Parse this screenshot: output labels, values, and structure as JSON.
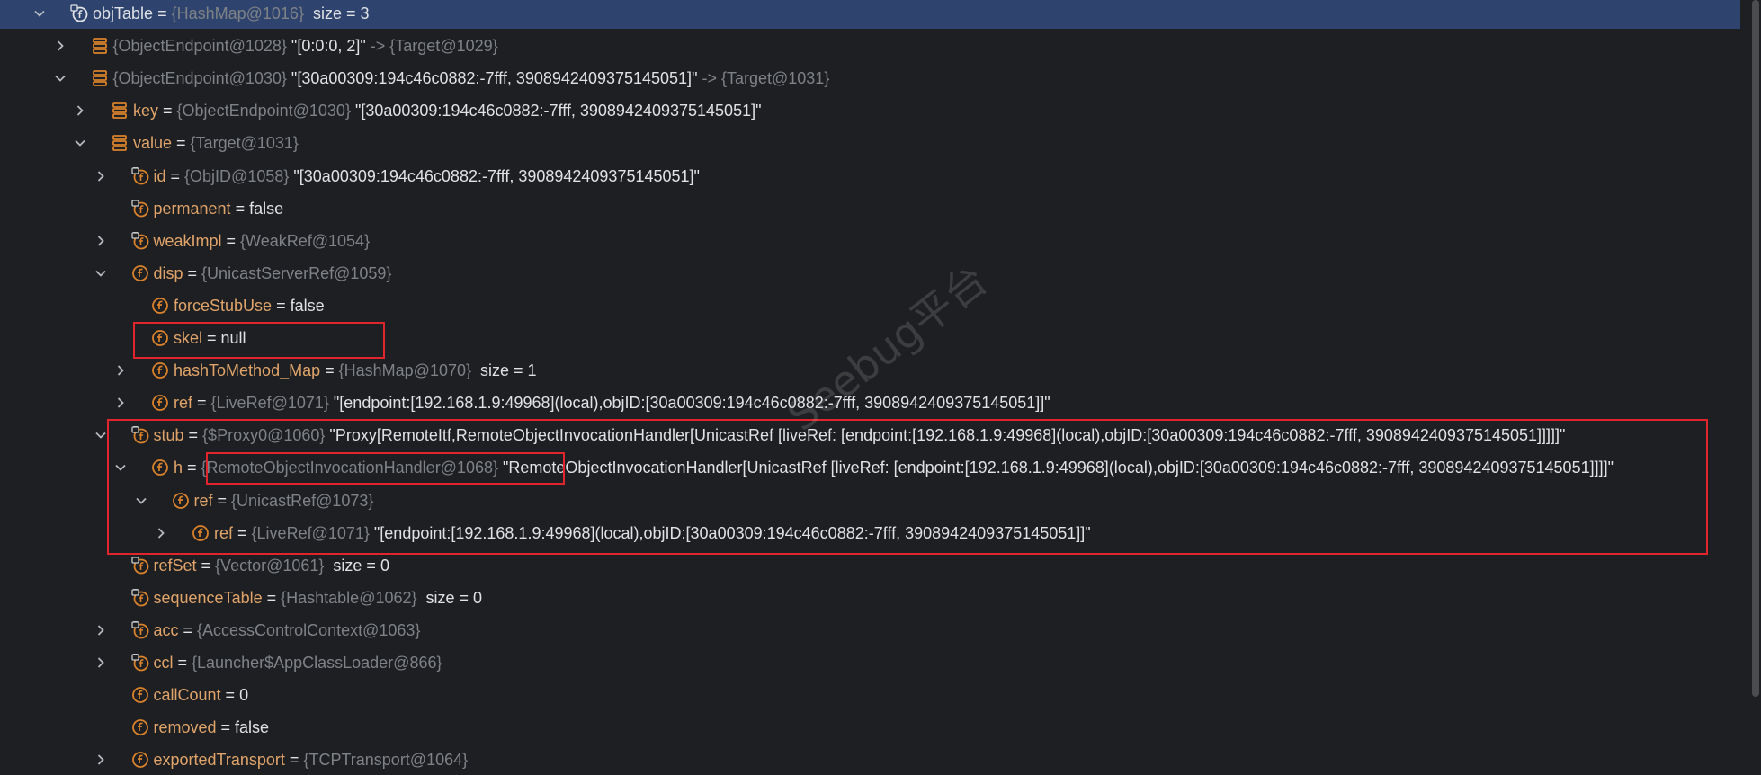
{
  "rows": [
    {
      "depth": 0,
      "expand": "open",
      "icon": "watch-icon",
      "selected": true,
      "name": "objTable",
      "op": " = ",
      "ref": "{HashMap@1016}",
      "value": "  size = 3",
      "name_color": "#dfe1e5"
    },
    {
      "depth": 1,
      "expand": "closed",
      "icon": "array-icon",
      "name": "",
      "op": "",
      "ref": "{ObjectEndpoint@1028}",
      "value": " \"[0:0:0, 2]\"",
      "suffix": " -> {Target@1029}"
    },
    {
      "depth": 1,
      "expand": "open",
      "icon": "array-icon",
      "name": "",
      "op": "",
      "ref": "{ObjectEndpoint@1030}",
      "value": " \"[30a00309:194c46c0882:-7fff, 3908942409375145051]\"",
      "suffix": " -> {Target@1031}"
    },
    {
      "depth": 2,
      "expand": "closed",
      "icon": "array-icon",
      "name": "key",
      "op": " = ",
      "ref": "{ObjectEndpoint@1030}",
      "value": " \"[30a00309:194c46c0882:-7fff, 3908942409375145051]\""
    },
    {
      "depth": 2,
      "expand": "open",
      "icon": "array-icon",
      "name": "value",
      "op": " = ",
      "ref": "{Target@1031}",
      "value": ""
    },
    {
      "depth": 3,
      "expand": "closed",
      "icon": "private-field-icon",
      "name": "id",
      "op": " = ",
      "ref": "{ObjID@1058}",
      "value": " \"[30a00309:194c46c0882:-7fff, 3908942409375145051]\""
    },
    {
      "depth": 3,
      "expand": "none",
      "icon": "private-field-icon",
      "name": "permanent",
      "op": " = ",
      "ref": "",
      "value": "false"
    },
    {
      "depth": 3,
      "expand": "closed",
      "icon": "private-field-icon",
      "name": "weakImpl",
      "op": " = ",
      "ref": "{WeakRef@1054}",
      "value": ""
    },
    {
      "depth": 3,
      "expand": "open",
      "icon": "field-icon",
      "name": "disp",
      "op": " = ",
      "ref": "{UnicastServerRef@1059}",
      "value": ""
    },
    {
      "depth": 4,
      "expand": "none",
      "icon": "field-icon",
      "name": "forceStubUse",
      "op": " = ",
      "ref": "",
      "value": "false"
    },
    {
      "depth": 4,
      "expand": "none",
      "icon": "field-icon",
      "name": "skel",
      "op": " = ",
      "ref": "",
      "value": "null"
    },
    {
      "depth": 4,
      "expand": "closed",
      "icon": "field-icon",
      "name": "hashToMethod_Map",
      "op": " = ",
      "ref": "{HashMap@1070}",
      "value": "  size = 1"
    },
    {
      "depth": 4,
      "expand": "closed",
      "icon": "field-icon",
      "name": "ref",
      "op": " = ",
      "ref": "{LiveRef@1071}",
      "value": " \"[endpoint:[192.168.1.9:49968](local),objID:[30a00309:194c46c0882:-7fff, 3908942409375145051]]\""
    },
    {
      "depth": 3,
      "expand": "open",
      "icon": "private-field-icon",
      "name": "stub",
      "op": " = ",
      "ref": "{$Proxy0@1060}",
      "value": " \"Proxy[RemoteItf,RemoteObjectInvocationHandler[UnicastRef [liveRef: [endpoint:[192.168.1.9:49968](local),objID:[30a00309:194c46c0882:-7fff, 3908942409375145051]]]]]\""
    },
    {
      "depth": 4,
      "expand": "open",
      "icon": "field-icon",
      "name": "h",
      "op": " = ",
      "ref": "{RemoteObjectInvocationHandler@1068}",
      "value": " \"RemoteObjectInvocationHandler[UnicastRef [liveRef: [endpoint:[192.168.1.9:49968](local),objID:[30a00309:194c46c0882:-7fff, 3908942409375145051]]]]\""
    },
    {
      "depth": 5,
      "expand": "open",
      "icon": "field-icon",
      "name": "ref",
      "op": " = ",
      "ref": "{UnicastRef@1073}",
      "value": ""
    },
    {
      "depth": 6,
      "expand": "closed",
      "icon": "field-icon",
      "name": "ref",
      "op": " = ",
      "ref": "{LiveRef@1071}",
      "value": " \"[endpoint:[192.168.1.9:49968](local),objID:[30a00309:194c46c0882:-7fff, 3908942409375145051]]\""
    },
    {
      "depth": 3,
      "expand": "none",
      "icon": "private-field-icon",
      "name": "refSet",
      "op": " = ",
      "ref": "{Vector@1061}",
      "value": "  size = 0"
    },
    {
      "depth": 3,
      "expand": "none",
      "icon": "private-field-icon",
      "name": "sequenceTable",
      "op": " = ",
      "ref": "{Hashtable@1062}",
      "value": "  size = 0"
    },
    {
      "depth": 3,
      "expand": "closed",
      "icon": "private-field-icon",
      "name": "acc",
      "op": " = ",
      "ref": "{AccessControlContext@1063}",
      "value": ""
    },
    {
      "depth": 3,
      "expand": "closed",
      "icon": "private-field-icon",
      "name": "ccl",
      "op": " = ",
      "ref": "{Launcher$AppClassLoader@866}",
      "value": ""
    },
    {
      "depth": 3,
      "expand": "none",
      "icon": "field-icon",
      "name": "callCount",
      "op": " = ",
      "ref": "",
      "value": "0"
    },
    {
      "depth": 3,
      "expand": "none",
      "icon": "field-icon",
      "name": "removed",
      "op": " = ",
      "ref": "",
      "value": "false"
    },
    {
      "depth": 3,
      "expand": "closed",
      "icon": "field-icon",
      "name": "exportedTransport",
      "op": " = ",
      "ref": "{TCPTransport@1064}",
      "value": ""
    }
  ],
  "watermark": "Seebug平台",
  "colors": {
    "background": "#1e1f22",
    "selection": "#2e436e",
    "field_name": "#e0a46a",
    "reference": "#7e8287",
    "value": "#dfe1e5",
    "icon_orange": "#d9822b",
    "highlight_box": "#e0262c"
  }
}
